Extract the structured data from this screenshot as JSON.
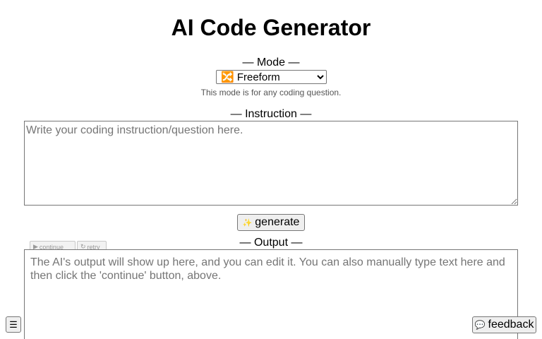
{
  "page": {
    "title": "AI Code Generator"
  },
  "mode": {
    "label": "— Mode —",
    "selected": "Freeform",
    "selected_display": "🔀 Freeform",
    "hint": "This mode is for any coding question."
  },
  "instruction": {
    "label": "— Instruction —",
    "placeholder": "Write your coding instruction/question here.",
    "value": ""
  },
  "generate": {
    "label": "generate",
    "icon": "sparkles-icon",
    "icon_glyph": "✨"
  },
  "output": {
    "label": "— Output —",
    "placeholder": "The AI's output will show up here, and you can edit it. You can also manually type text here and then click the 'continue' button, above.",
    "value": "",
    "continue_label": "continue",
    "continue_icon": "play-icon",
    "continue_glyph": "▶",
    "retry_label": "retry",
    "retry_icon": "retry-icon",
    "retry_glyph": "↻"
  },
  "corner": {
    "icon": "menu-icon",
    "glyph": "☰"
  },
  "feedback": {
    "label": "feedback",
    "icon": "speech-bubble-icon",
    "glyph": "💬"
  },
  "colors": {
    "button_bg": "#efefef",
    "border": "#767676",
    "placeholder": "#757575",
    "hint_text": "#555555"
  }
}
